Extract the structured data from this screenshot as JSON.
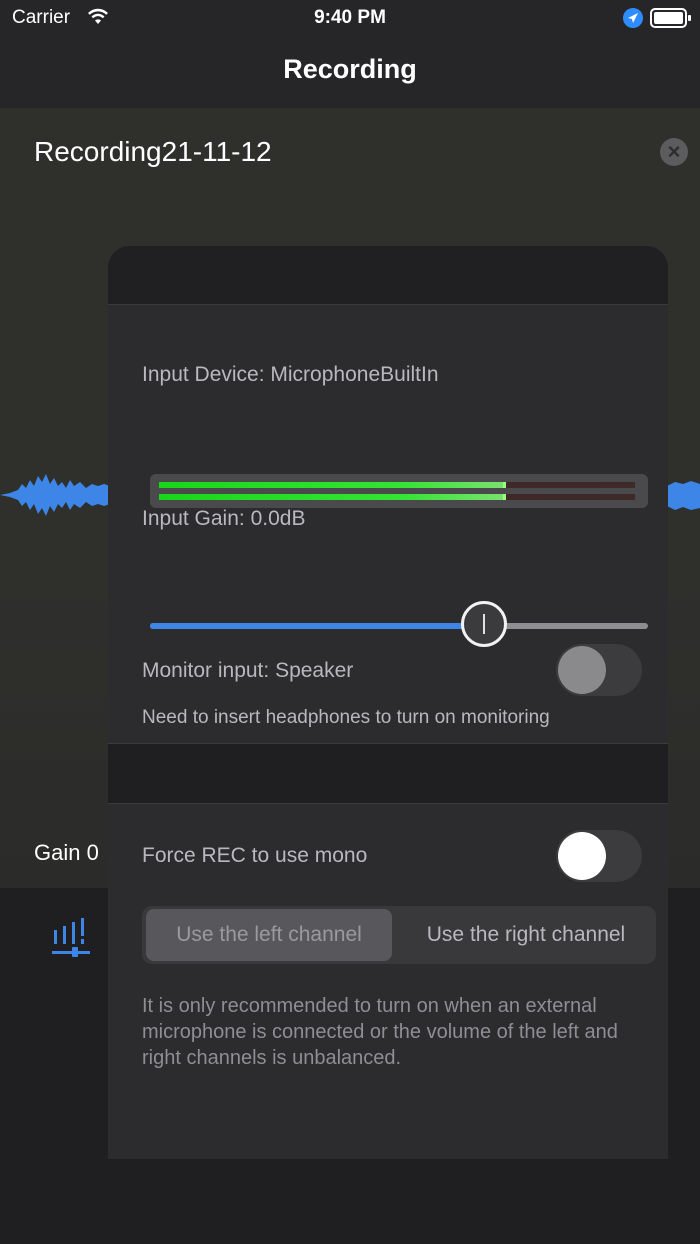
{
  "status_bar": {
    "carrier": "Carrier",
    "time": "9:40 PM",
    "icons": [
      "wifi-icon",
      "location-arrow-icon",
      "battery-icon"
    ]
  },
  "nav": {
    "title": "Recording"
  },
  "background": {
    "recording_name": "Recording21-11-12",
    "close_icon": "close-icon",
    "gain_label": "Gain  0"
  },
  "popover": {
    "input_device_label": "Input Device: MicrophoneBuiltIn",
    "level_meter": {
      "left_level": 0.73,
      "right_level": 0.73
    },
    "input_gain_label": "Input Gain: 0.0dB",
    "gain_slider": {
      "value": 0.67
    },
    "monitor_label": "Monitor input: Speaker",
    "monitor_enabled": false,
    "monitor_hint": "Need to insert headphones to turn on monitoring",
    "force_mono_label": "Force REC to use mono",
    "force_mono_enabled": false,
    "channel_segment": {
      "left": "Use the left channel",
      "right": "Use the right channel",
      "selected": "left"
    },
    "mono_note": "It is only recommended to turn on when an external microphone is connected or the volume of the left and right channels is unbalanced."
  },
  "colors": {
    "accent": "#3d86e8",
    "meter_green": "#19d619"
  }
}
